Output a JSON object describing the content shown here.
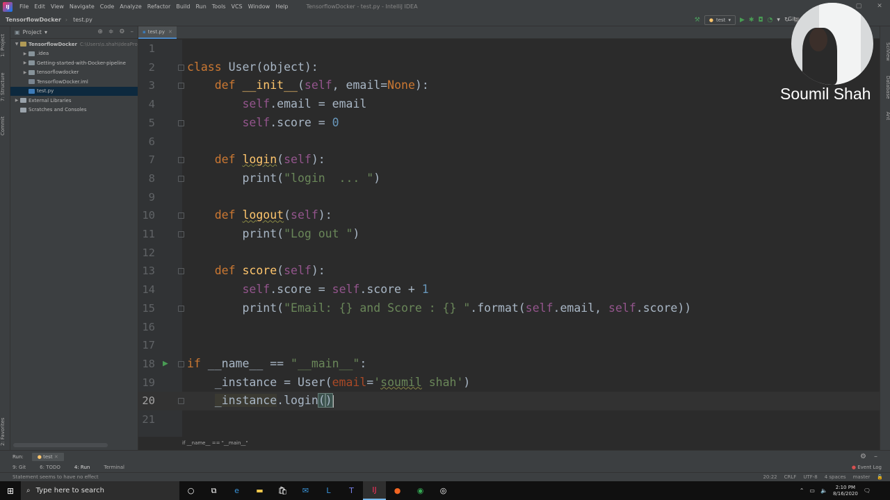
{
  "menubar": {
    "items": [
      "File",
      "Edit",
      "View",
      "Navigate",
      "Code",
      "Analyze",
      "Refactor",
      "Build",
      "Run",
      "Tools",
      "VCS",
      "Window",
      "Help"
    ],
    "window_title": "TensorflowDocker - test.py - IntelliJ IDEA"
  },
  "navbar": {
    "project": "TensorflowDocker",
    "file": "test.py",
    "run_config": "test",
    "git_label": "Git:"
  },
  "project_panel": {
    "title": "Project",
    "tree": [
      {
        "label": "TensorflowDocker",
        "path": "C:\\Users\\s.shah\\IdeaPro",
        "icon": "folder-root",
        "depth": 0,
        "expanded": true
      },
      {
        "label": ".idea",
        "icon": "folder",
        "depth": 1,
        "expanded": false
      },
      {
        "label": "Getting-started-with-Docker-pipeline",
        "icon": "folder",
        "depth": 1,
        "expanded": false
      },
      {
        "label": "tensorflowdocker",
        "icon": "folder",
        "depth": 1,
        "expanded": false
      },
      {
        "label": "TensorflowDocker.iml",
        "icon": "file-iml",
        "depth": 1
      },
      {
        "label": "test.py",
        "icon": "file-py",
        "depth": 1,
        "selected": true
      },
      {
        "label": "External Libraries",
        "icon": "lib",
        "depth": 0,
        "expanded": false
      },
      {
        "label": "Scratches and Consoles",
        "icon": "scratch",
        "depth": 0
      }
    ]
  },
  "left_strip": {
    "project_tab": "1: Project",
    "structure_tab": "7: Structure",
    "commit_tab": "Commit",
    "favorites_tab": "2: Favorites"
  },
  "right_strip": {
    "sciview_tab": "SciView",
    "database_tab": "Database",
    "ant_tab": "Ant"
  },
  "editor": {
    "tab_label": "test.py",
    "current_line": 20,
    "lines": [
      {
        "n": "1",
        "html": ""
      },
      {
        "n": "2",
        "html": "<span class=\"kw\">class</span> User(object):"
      },
      {
        "n": "3",
        "html": "    <span class=\"kw\">def</span> <span class=\"fn\">__init__</span>(<span class=\"self\">self</span>, email=<span class=\"kw\">None</span>):"
      },
      {
        "n": "4",
        "html": "        <span class=\"self\">self</span>.email = email"
      },
      {
        "n": "5",
        "html": "        <span class=\"self\">self</span>.score = <span class=\"num\">0</span>"
      },
      {
        "n": "6",
        "html": ""
      },
      {
        "n": "7",
        "html": "    <span class=\"kw\">def</span> <span class=\"fn ul\">login</span>(<span class=\"self\">self</span>):"
      },
      {
        "n": "8",
        "html": "        print(<span class=\"str\">\"login  ... \"</span>)"
      },
      {
        "n": "9",
        "html": ""
      },
      {
        "n": "10",
        "html": "    <span class=\"kw\">def</span> <span class=\"fn ul\">logout</span>(<span class=\"self\">self</span>):"
      },
      {
        "n": "11",
        "html": "        print(<span class=\"str\">\"Log out \"</span>)"
      },
      {
        "n": "12",
        "html": ""
      },
      {
        "n": "13",
        "html": "    <span class=\"kw\">def</span> <span class=\"fn\">score</span>(<span class=\"self\">self</span>):"
      },
      {
        "n": "14",
        "html": "        <span class=\"self\">self</span>.score = <span class=\"self\">self</span>.score + <span class=\"num\">1</span>"
      },
      {
        "n": "15",
        "html": "        print(<span class=\"str\">\"Email: {} and Score : {} \"</span>.format(<span class=\"self\">self</span>.email, <span class=\"self\">self</span>.score))"
      },
      {
        "n": "16",
        "html": ""
      },
      {
        "n": "17",
        "html": ""
      },
      {
        "n": "18",
        "html": "<span class=\"kw\">if</span> __name__ == <span class=\"str\">\"__main__\"</span>:"
      },
      {
        "n": "19",
        "html": "    _instance = User(<span class=\"param\">email</span>=<span class=\"str\">'<span class=\"ul\">soumil</span> shah'</span>)"
      },
      {
        "n": "20",
        "html": "    <span class=\"warn-bg\">_instance</span>.login<span class=\"bracket\">(</span><span class=\"bracket\">)</span><span class=\"caret\"></span>"
      },
      {
        "n": "21",
        "html": ""
      }
    ],
    "fold_lines": [
      2,
      3,
      5,
      7,
      8,
      10,
      11,
      13,
      15,
      18,
      20
    ],
    "breadcrumb": "if __name__ == \"__main__\""
  },
  "webcam": {
    "presenter_name": "Soumil Shah"
  },
  "run_bar": {
    "label": "Run:",
    "tab": "test"
  },
  "tool_tabs": {
    "git": "9: Git",
    "todo": "6: TODO",
    "run": "4: Run",
    "terminal": "Terminal",
    "event_log": "Event Log"
  },
  "status_bar": {
    "message": "Statement seems to have no effect",
    "position": "20:22",
    "line_sep": "CRLF",
    "encoding": "UTF-8",
    "indent": "4 spaces",
    "branch": "master"
  },
  "taskbar": {
    "search_placeholder": "Type here to search",
    "time": "2:10 PM",
    "date": "8/16/2020"
  },
  "colors": {
    "keyword": "#cc7832",
    "string": "#6a8759",
    "number": "#6897bb",
    "self": "#94558d",
    "function": "#ffc66d",
    "editor_bg": "#2b2b2b",
    "panel_bg": "#3c3f41"
  }
}
